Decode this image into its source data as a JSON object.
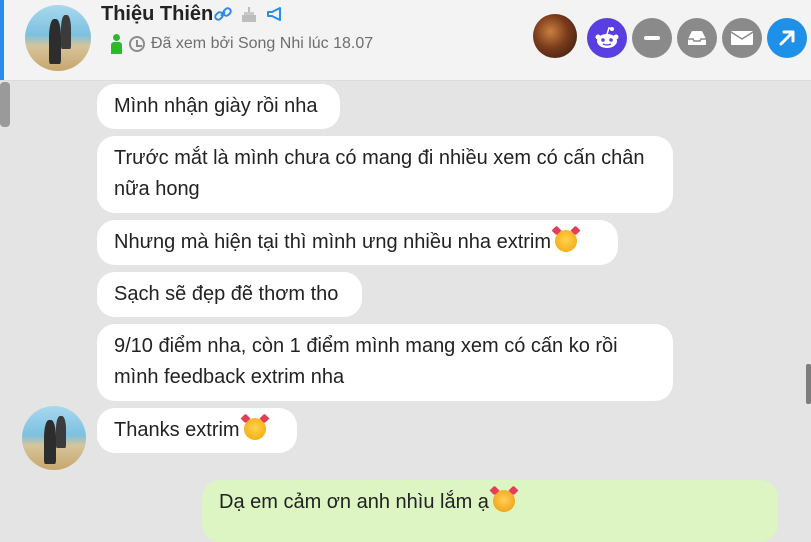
{
  "header": {
    "contact_name": "Thiệu Thiên",
    "seen_status": "Đã xem bởi Song Nhi lúc 18.07",
    "name_icons": [
      "link-icon",
      "cake-icon",
      "megaphone-icon"
    ],
    "actions": [
      "profile-photo",
      "reddit-icon",
      "minus-icon",
      "tray-icon",
      "mail-icon",
      "share-arrow-icon"
    ]
  },
  "messages": [
    {
      "from": "contact",
      "text": "Mình nhận giày rồi nha"
    },
    {
      "from": "contact",
      "text": "Trước mắt là mình chưa có mang đi nhiều xem có cấn chân nữa hong"
    },
    {
      "from": "contact",
      "text": "Nhưng mà hiện tại thì mình ưng nhiều nha extrim"
    },
    {
      "from": "contact",
      "text": "Sạch sẽ đẹp đẽ thơm tho"
    },
    {
      "from": "contact",
      "text": "9/10 điểm nha, còn 1 điểm mình mang xem có cấn ko rồi mình feedback extrim nha"
    },
    {
      "from": "contact",
      "text": "Thanks extrim"
    },
    {
      "from": "me",
      "text": "Dạ em cảm ơn anh nhìu lắm ạ"
    }
  ],
  "colors": {
    "outgoing_bubble": "#dcf5c3",
    "incoming_bubble": "#ffffff",
    "background": "#e4e4e4",
    "share_button": "#1e90e8",
    "reddit_button": "#5a3fe0"
  }
}
